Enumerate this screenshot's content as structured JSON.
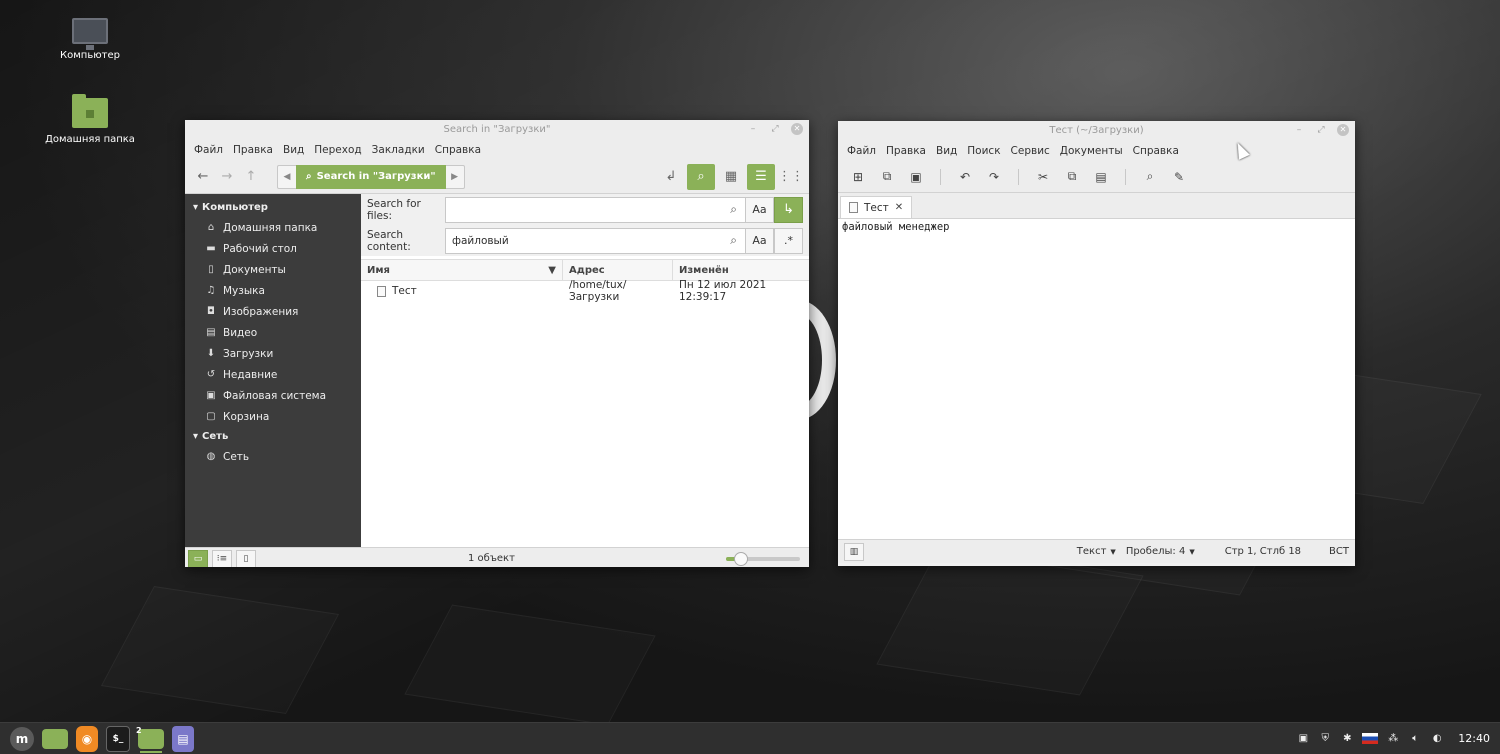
{
  "desktop": {
    "icons": [
      {
        "label": "Компьютер",
        "icon": "computer-icon"
      },
      {
        "label": "Домашняя папка",
        "icon": "home-folder-icon"
      }
    ]
  },
  "nemo": {
    "title": "Search in \"Загрузки\"",
    "menu": [
      "Файл",
      "Правка",
      "Вид",
      "Переход",
      "Закладки",
      "Справка"
    ],
    "breadcrumb": "Search in \"Загрузки\"",
    "sidebar": {
      "computer_heading": "Компьютер",
      "computer_items": [
        {
          "label": "Домашняя папка",
          "icon": "home-icon"
        },
        {
          "label": "Рабочий стол",
          "icon": "desktop-icon"
        },
        {
          "label": "Документы",
          "icon": "documents-icon"
        },
        {
          "label": "Музыка",
          "icon": "music-icon"
        },
        {
          "label": "Изображения",
          "icon": "pictures-icon"
        },
        {
          "label": "Видео",
          "icon": "video-icon"
        },
        {
          "label": "Загрузки",
          "icon": "downloads-icon"
        },
        {
          "label": "Недавние",
          "icon": "recent-icon"
        },
        {
          "label": "Файловая система",
          "icon": "filesystem-icon"
        },
        {
          "label": "Корзина",
          "icon": "trash-icon"
        }
      ],
      "network_heading": "Сеть",
      "network_items": [
        {
          "label": "Сеть",
          "icon": "network-icon"
        }
      ]
    },
    "search": {
      "files_label": "Search for files:",
      "files_value": "",
      "content_label": "Search content:",
      "content_value": "файловый",
      "case_label": "Aa",
      "regex_label": ".*"
    },
    "columns": [
      "Имя",
      "Адрес",
      "Изменён"
    ],
    "files": [
      {
        "name": "Тест",
        "location": "/home/tux/Загрузки",
        "modified": "Пн 12 июл 2021 12:39:17"
      }
    ],
    "status": "1 объект"
  },
  "xed": {
    "title": "Тест (~/Загрузки)",
    "menu": [
      "Файл",
      "Правка",
      "Вид",
      "Поиск",
      "Сервис",
      "Документы",
      "Справка"
    ],
    "tab_label": "Тест",
    "content": "файловый менеджер",
    "status": {
      "language": "Текст",
      "spaces": "Пробелы: 4",
      "position": "Стр 1, Стлб 18",
      "mode": "ВСТ"
    }
  },
  "panel": {
    "workspace_badge": "2",
    "clock": "12:40"
  },
  "colors": {
    "accent": "#8bb158",
    "sidebar_bg": "#3c3c3c",
    "panel_bg": "#2f2f2f"
  }
}
